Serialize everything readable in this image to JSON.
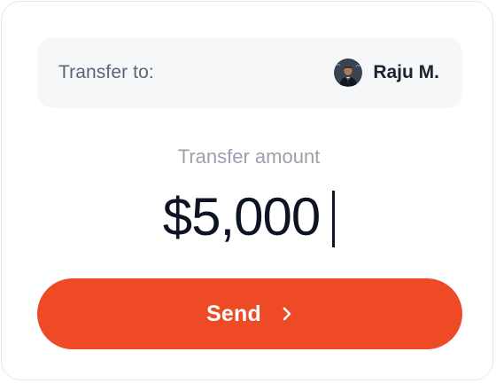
{
  "recipient": {
    "label": "Transfer to:",
    "name": "Raju M.",
    "avatar_icon": "user-avatar-photo"
  },
  "amount": {
    "label": "Transfer amount",
    "value": "$5,000"
  },
  "actions": {
    "send_label": "Send",
    "send_icon": "chevron-right-icon"
  },
  "colors": {
    "accent": "#ee4a25",
    "text_primary": "#0f1424",
    "text_muted": "#9aa1ad",
    "panel_bg": "#f6f7f9"
  }
}
